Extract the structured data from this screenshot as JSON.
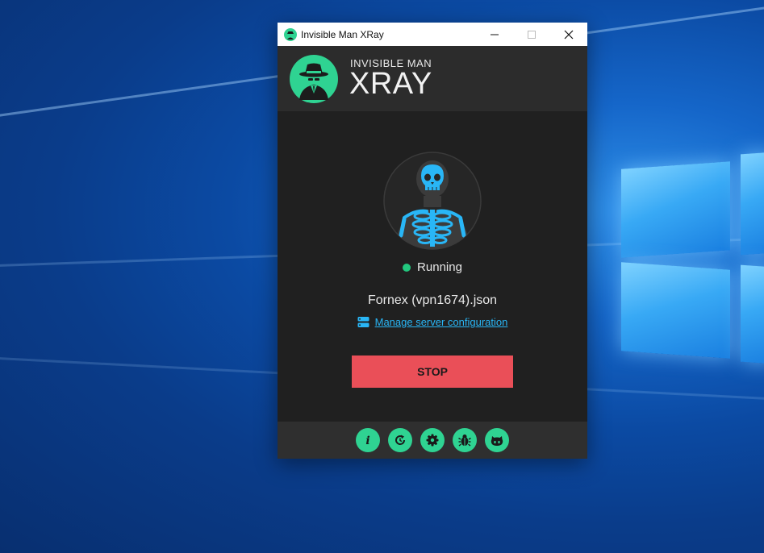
{
  "window": {
    "title": "Invisible Man XRay",
    "controls": {
      "minimize": "minimize",
      "maximize": "maximize",
      "close": "close"
    }
  },
  "header": {
    "brand_small": "INVISIBLE MAN",
    "brand_big": "XRAY"
  },
  "main": {
    "status": "Running",
    "status_color": "#22c77e",
    "config_name": "Fornex (vpn1674).json",
    "manage_link": "Manage server configuration",
    "stop_label": "STOP"
  },
  "footer": {
    "buttons": [
      {
        "icon": "info-icon"
      },
      {
        "icon": "update-icon"
      },
      {
        "icon": "settings-icon"
      },
      {
        "icon": "bug-icon"
      },
      {
        "icon": "github-icon"
      }
    ]
  },
  "colors": {
    "accent": "#2fd392",
    "stop": "#ea4f58",
    "link": "#29b6f6"
  }
}
